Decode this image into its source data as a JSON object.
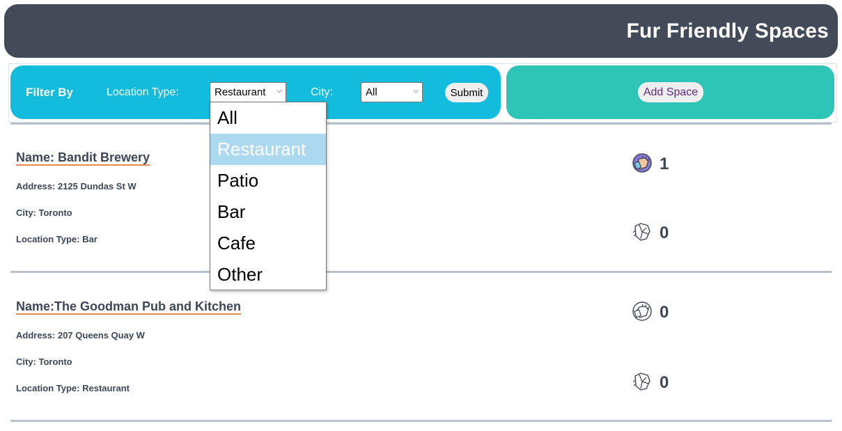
{
  "header": {
    "title": "Fur Friendly Spaces"
  },
  "filter": {
    "title": "Filter By",
    "location_type_label": "Location Type:",
    "location_type_value": "Restaurant",
    "city_label": "City:",
    "city_value": "All",
    "submit_label": "Submit"
  },
  "add_space": {
    "label": "Add Space"
  },
  "dropdown": {
    "options": [
      "All",
      "Restaurant",
      "Patio",
      "Bar",
      "Cafe",
      "Other"
    ],
    "selected": "Restaurant"
  },
  "entries": [
    {
      "name": "Name: Bandit Brewery",
      "address": "Address: 2125 Dundas St W",
      "city": "City: Toronto",
      "location_type": "Location Type: Bar",
      "upvotes": "1",
      "downvotes": "0",
      "upvote_icon": "paw-up-icon-colored",
      "downvote_icon": "paw-down-icon"
    },
    {
      "name": "Name:The Goodman Pub and Kitchen",
      "address": "Address: 207 Queens Quay W",
      "city": "City: Toronto",
      "location_type": "Location Type: Restaurant",
      "upvotes": "0",
      "downvotes": "0",
      "upvote_icon": "paw-up-icon",
      "downvote_icon": "paw-down-icon"
    }
  ],
  "colors": {
    "header_bg": "#434b59",
    "filter_bg": "#13bcdc",
    "add_bg": "#2ec4b6",
    "accent_underline": "#e8894a",
    "selected_option_bg": "#add9f0"
  }
}
